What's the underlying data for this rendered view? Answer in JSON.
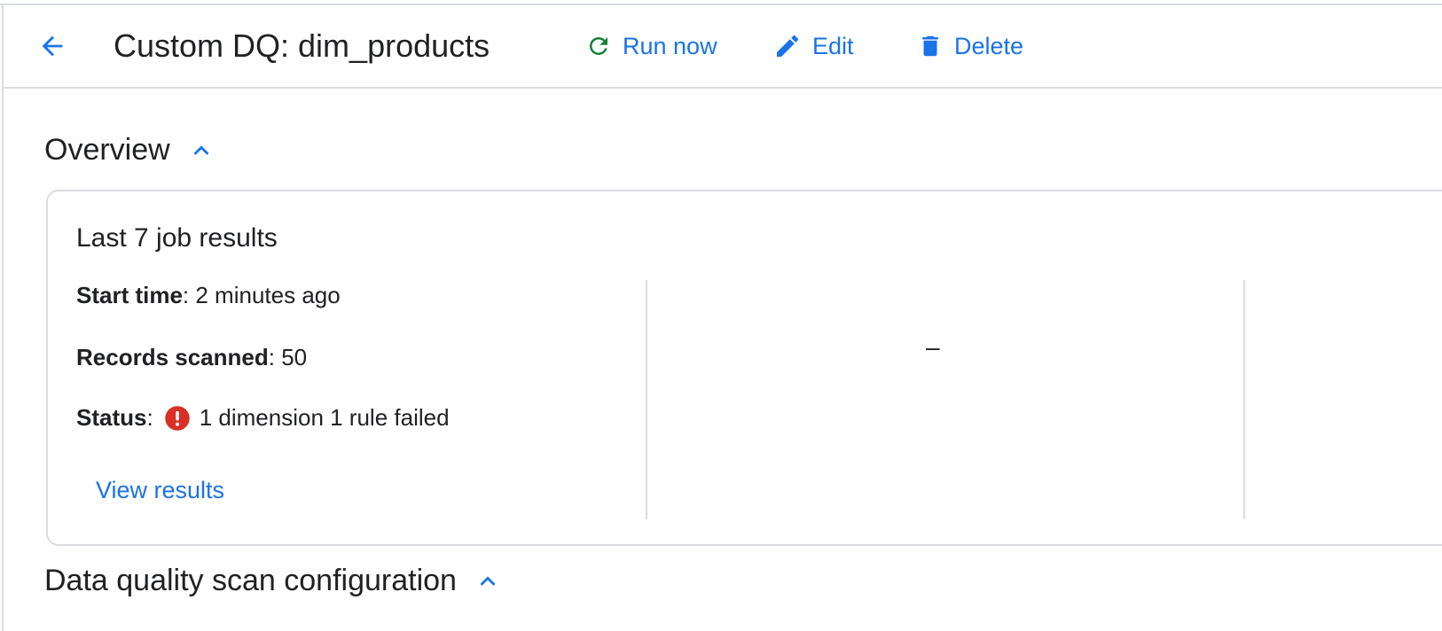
{
  "header": {
    "title": "Custom DQ: dim_products",
    "back_icon": "arrow-left-icon",
    "actions": {
      "run_now": "Run now",
      "edit": "Edit",
      "delete": "Delete"
    }
  },
  "overview": {
    "heading": "Overview",
    "toggle_icon": "chevron-up-icon",
    "card": {
      "title": "Last 7 job results",
      "start_time": {
        "label": "Start time",
        "value": ": 2 minutes ago"
      },
      "records_scanned": {
        "label": "Records scanned",
        "value": ": 50"
      },
      "status": {
        "label": "Status",
        "separator": ":",
        "value": "1 dimension 1 rule failed",
        "icon": "error-icon"
      },
      "view_results": "View results",
      "middle_value": "–"
    }
  },
  "config": {
    "heading": "Data quality scan configuration",
    "toggle_icon": "chevron-up-icon"
  },
  "colors": {
    "accent": "#1a73e8",
    "success": "#188038",
    "error": "#d93025",
    "border": "#dadce0",
    "text": "#202124"
  }
}
